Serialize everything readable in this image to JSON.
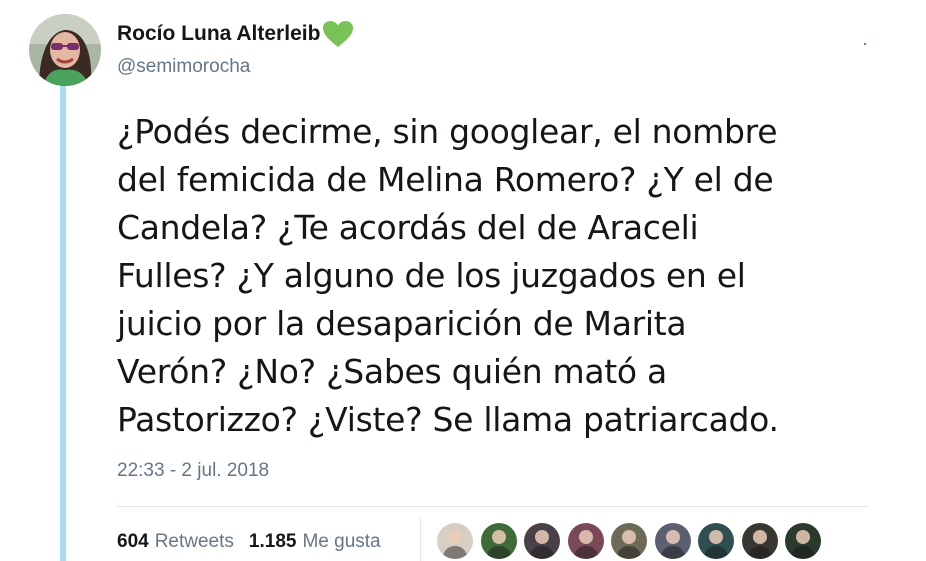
{
  "author": {
    "display_name": "Rocío Luna Alterleib",
    "handle": "@semimorocha",
    "name_emoji": "green-heart-icon",
    "avatar_icon": "user-avatar"
  },
  "tweet": {
    "text": "¿Podés decirme, sin googlear, el nombre\ndel femicida de Melina Romero? ¿Y el de\nCandela? ¿Te acordás del de Araceli\nFulles? ¿Y alguno de los juzgados en el\njuicio por la desaparición de Marita\nVerón? ¿No? ¿Sabes quién mató a\nPastorizzo? ¿Viste? Se llama patriarcado.",
    "timestamp": "22:33 - 2 jul. 2018"
  },
  "stats": {
    "retweets_count": "604",
    "retweets_label": "Retweets",
    "likes_count": "1.185",
    "likes_label": "Me gusta"
  },
  "likers": [
    {
      "icon": "liker-avatar",
      "color": "#d8cfc4"
    },
    {
      "icon": "liker-avatar",
      "color": "#3f6a3a"
    },
    {
      "icon": "liker-avatar",
      "color": "#4a4048"
    },
    {
      "icon": "liker-avatar",
      "color": "#7a4a58"
    },
    {
      "icon": "liker-avatar",
      "color": "#6e6a58"
    },
    {
      "icon": "liker-avatar",
      "color": "#5a6070"
    },
    {
      "icon": "liker-avatar",
      "color": "#2f4f52"
    },
    {
      "icon": "liker-avatar",
      "color": "#3a3632"
    },
    {
      "icon": "liker-avatar",
      "color": "#2a3a2c"
    }
  ],
  "colors": {
    "thread_line": "#a9dcec",
    "name_heart": "#78c257",
    "secondary_text": "#657786",
    "primary_text": "#14171a",
    "divider": "#e1e8ed"
  }
}
